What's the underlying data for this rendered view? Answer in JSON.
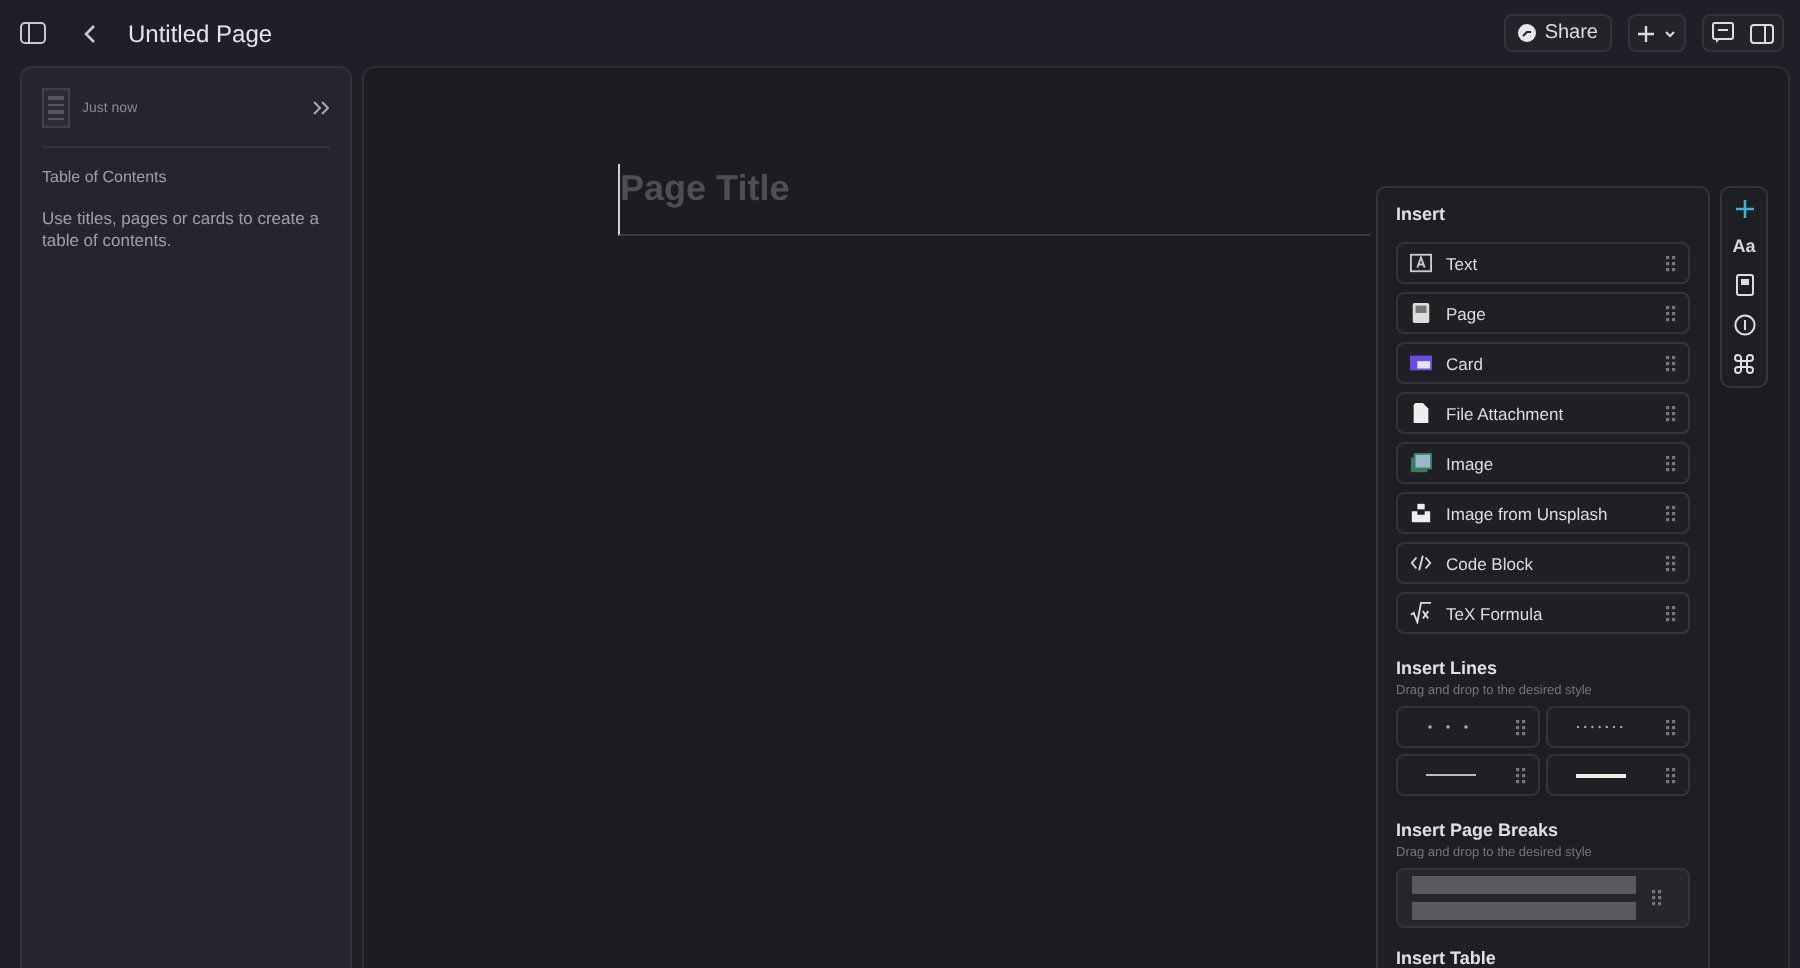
{
  "topbar": {
    "title": "Untitled Page",
    "share": "Share"
  },
  "sidebar": {
    "timestamp": "Just now",
    "toc_heading": "Table of Contents",
    "toc_hint": "Use titles, pages or cards to create a table of contents."
  },
  "editor": {
    "title_placeholder": "Page Title"
  },
  "insert_panel": {
    "heading": "Insert",
    "items": [
      {
        "label": "Text",
        "kind": "text"
      },
      {
        "label": "Page",
        "kind": "page"
      },
      {
        "label": "Card",
        "kind": "card"
      },
      {
        "label": "File Attachment",
        "kind": "file"
      },
      {
        "label": "Image",
        "kind": "image"
      },
      {
        "label": "Image from Unsplash",
        "kind": "unsplash"
      },
      {
        "label": "Code Block",
        "kind": "code"
      },
      {
        "label": "TeX Formula",
        "kind": "tex"
      }
    ],
    "lines_heading": "Insert Lines",
    "lines_hint": "Drag and drop to the desired style",
    "lines": [
      {
        "kind": "sparse-dots"
      },
      {
        "kind": "dense-dots"
      },
      {
        "kind": "thin"
      },
      {
        "kind": "thick"
      }
    ],
    "breaks_heading": "Insert Page Breaks",
    "breaks_hint": "Drag and drop to the desired style",
    "table_heading": "Insert Table"
  },
  "side_tools": {
    "plus_selected": true,
    "font_label": "Aa"
  }
}
